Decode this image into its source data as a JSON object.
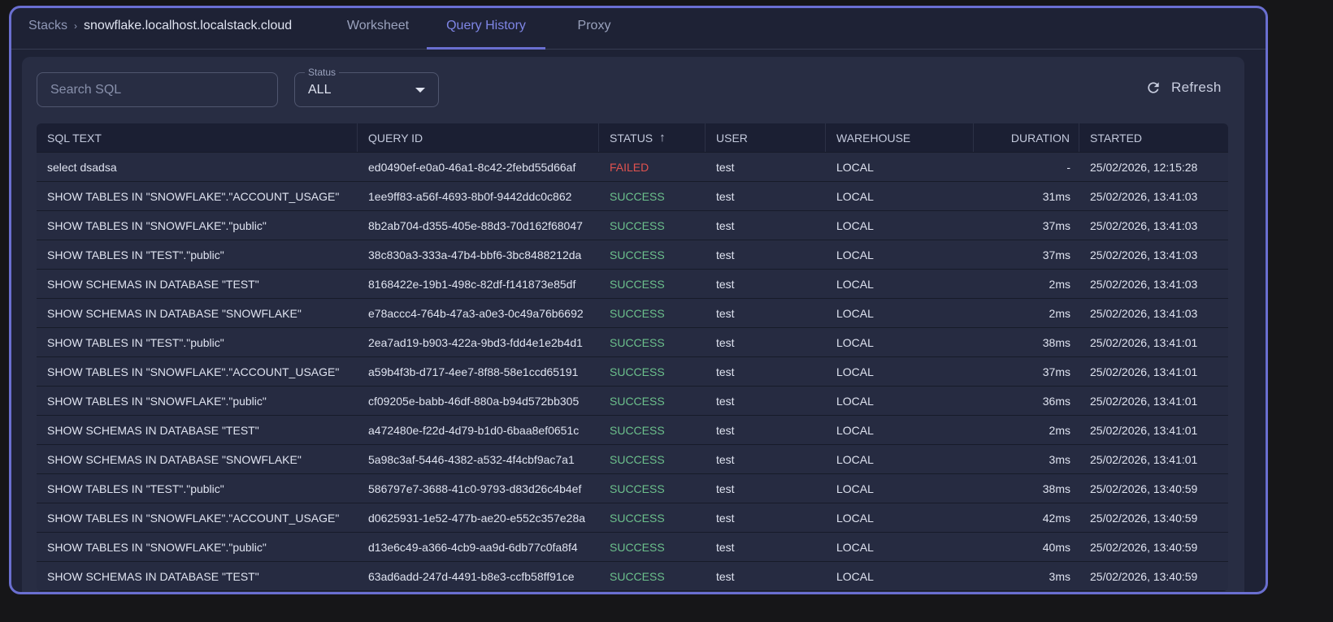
{
  "breadcrumb": {
    "root": "Stacks",
    "host": "snowflake.localhost.localstack.cloud"
  },
  "tabs": [
    {
      "label": "Worksheet"
    },
    {
      "label": "Query History",
      "active": true
    },
    {
      "label": "Proxy"
    }
  ],
  "search": {
    "placeholder": "Search SQL",
    "value": ""
  },
  "status_filter": {
    "label": "Status",
    "value": "ALL"
  },
  "refresh": {
    "label": "Refresh",
    "icon": "refresh-icon"
  },
  "colors": {
    "accent": "#6a6fd0",
    "success": "#6cc08c",
    "failed": "#e0524f"
  },
  "table": {
    "columns": [
      "SQL TEXT",
      "QUERY ID",
      "STATUS",
      "USER",
      "WAREHOUSE",
      "DURATION",
      "STARTED"
    ],
    "sort": {
      "column": "STATUS",
      "direction": "ascending"
    },
    "rows": [
      [
        "select dsadsa",
        "ed0490ef-e0a0-46a1-8c42-2febd55d66af",
        "FAILED",
        "test",
        "LOCAL",
        "-",
        "25/02/2026, 12:15:28"
      ],
      [
        "SHOW TABLES IN \"SNOWFLAKE\".\"ACCOUNT_USAGE\"",
        "1ee9ff83-a56f-4693-8b0f-9442ddc0c862",
        "SUCCESS",
        "test",
        "LOCAL",
        "31ms",
        "25/02/2026, 13:41:03"
      ],
      [
        "SHOW TABLES IN \"SNOWFLAKE\".\"public\"",
        "8b2ab704-d355-405e-88d3-70d162f68047",
        "SUCCESS",
        "test",
        "LOCAL",
        "37ms",
        "25/02/2026, 13:41:03"
      ],
      [
        "SHOW TABLES IN \"TEST\".\"public\"",
        "38c830a3-333a-47b4-bbf6-3bc8488212da",
        "SUCCESS",
        "test",
        "LOCAL",
        "37ms",
        "25/02/2026, 13:41:03"
      ],
      [
        "SHOW SCHEMAS IN DATABASE \"TEST\"",
        "8168422e-19b1-498c-82df-f141873e85df",
        "SUCCESS",
        "test",
        "LOCAL",
        "2ms",
        "25/02/2026, 13:41:03"
      ],
      [
        "SHOW SCHEMAS IN DATABASE \"SNOWFLAKE\"",
        "e78accc4-764b-47a3-a0e3-0c49a76b6692",
        "SUCCESS",
        "test",
        "LOCAL",
        "2ms",
        "25/02/2026, 13:41:03"
      ],
      [
        "SHOW TABLES IN \"TEST\".\"public\"",
        "2ea7ad19-b903-422a-9bd3-fdd4e1e2b4d1",
        "SUCCESS",
        "test",
        "LOCAL",
        "38ms",
        "25/02/2026, 13:41:01"
      ],
      [
        "SHOW TABLES IN \"SNOWFLAKE\".\"ACCOUNT_USAGE\"",
        "a59b4f3b-d717-4ee7-8f88-58e1ccd65191",
        "SUCCESS",
        "test",
        "LOCAL",
        "37ms",
        "25/02/2026, 13:41:01"
      ],
      [
        "SHOW TABLES IN \"SNOWFLAKE\".\"public\"",
        "cf09205e-babb-46df-880a-b94d572bb305",
        "SUCCESS",
        "test",
        "LOCAL",
        "36ms",
        "25/02/2026, 13:41:01"
      ],
      [
        "SHOW SCHEMAS IN DATABASE \"TEST\"",
        "a472480e-f22d-4d79-b1d0-6baa8ef0651c",
        "SUCCESS",
        "test",
        "LOCAL",
        "2ms",
        "25/02/2026, 13:41:01"
      ],
      [
        "SHOW SCHEMAS IN DATABASE \"SNOWFLAKE\"",
        "5a98c3af-5446-4382-a532-4f4cbf9ac7a1",
        "SUCCESS",
        "test",
        "LOCAL",
        "3ms",
        "25/02/2026, 13:41:01"
      ],
      [
        "SHOW TABLES IN \"TEST\".\"public\"",
        "586797e7-3688-41c0-9793-d83d26c4b4ef",
        "SUCCESS",
        "test",
        "LOCAL",
        "38ms",
        "25/02/2026, 13:40:59"
      ],
      [
        "SHOW TABLES IN \"SNOWFLAKE\".\"ACCOUNT_USAGE\"",
        "d0625931-1e52-477b-ae20-e552c357e28a",
        "SUCCESS",
        "test",
        "LOCAL",
        "42ms",
        "25/02/2026, 13:40:59"
      ],
      [
        "SHOW TABLES IN \"SNOWFLAKE\".\"public\"",
        "d13e6c49-a366-4cb9-aa9d-6db77c0fa8f4",
        "SUCCESS",
        "test",
        "LOCAL",
        "40ms",
        "25/02/2026, 13:40:59"
      ],
      [
        "SHOW SCHEMAS IN DATABASE \"TEST\"",
        "63ad6add-247d-4491-b8e3-ccfb58ff91ce",
        "SUCCESS",
        "test",
        "LOCAL",
        "3ms",
        "25/02/2026, 13:40:59"
      ]
    ]
  }
}
